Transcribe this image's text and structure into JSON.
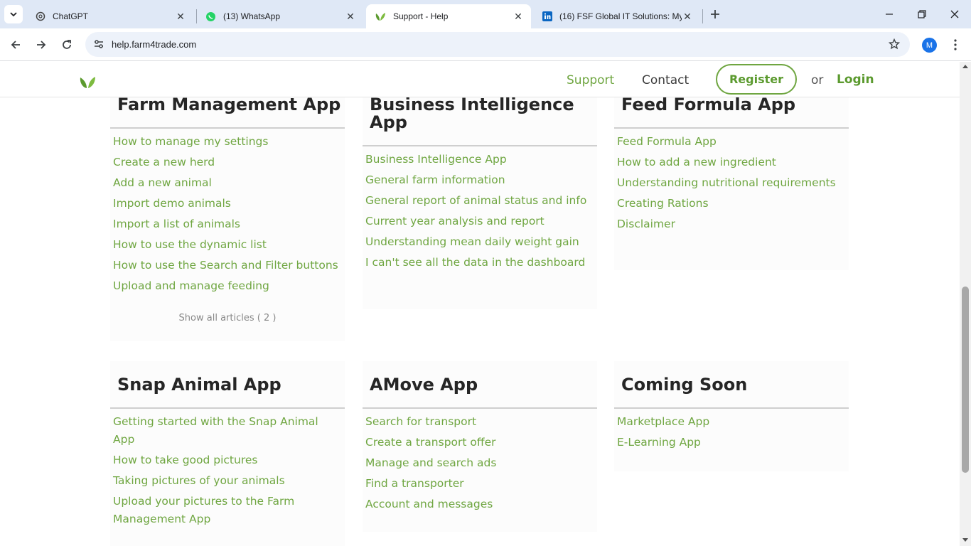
{
  "browser": {
    "tabs": [
      {
        "title": "ChatGPT",
        "icon": "chatgpt-icon"
      },
      {
        "title": "(13) WhatsApp",
        "icon": "whatsapp-icon"
      },
      {
        "title": "Support - Help",
        "icon": "leaf-icon",
        "active": true
      },
      {
        "title": "(16) FSF Global IT Solutions: My",
        "icon": "linkedin-icon"
      }
    ],
    "url": "help.farm4trade.com",
    "profile_initial": "M"
  },
  "header": {
    "nav_support": "Support",
    "nav_contact": "Contact",
    "register": "Register",
    "or": "or",
    "login": "Login"
  },
  "cards": [
    {
      "title": "Farm Management App",
      "articles": [
        "How to manage my settings",
        "Create a new herd",
        "Add a new animal",
        "Import demo animals",
        "Import a list of animals",
        "How to use the dynamic list",
        "How to use the Search and Filter buttons",
        "Upload and manage feeding"
      ],
      "show_all": "Show all articles ( 2 )"
    },
    {
      "title": "Business Intelligence App",
      "articles": [
        "Business Intelligence App",
        "General farm information",
        "General report of animal status and info",
        "Current year analysis and report",
        "Understanding mean daily weight gain",
        "I can't see all the data in the dashboard"
      ]
    },
    {
      "title": "Feed Formula App",
      "articles": [
        "Feed Formula App",
        "How to add a new ingredient",
        "Understanding nutritional requirements",
        "Creating Rations",
        "Disclaimer"
      ]
    },
    {
      "title": "Snap Animal App",
      "articles": [
        "Getting started with the Snap Animal App",
        "How to take good pictures",
        "Taking pictures of your animals",
        "Upload your pictures to the Farm Management App"
      ]
    },
    {
      "title": "AMove App",
      "articles": [
        "Search for transport",
        "Create a transport offer",
        "Manage and search ads",
        "Find a transporter",
        "Account and messages"
      ]
    },
    {
      "title": "Coming Soon",
      "articles": [
        "Marketplace App",
        "E-Learning App"
      ]
    }
  ],
  "colors": {
    "brand_green": "#6fa641",
    "tabbar_bg": "#dfe8f6",
    "heading": "#262626"
  }
}
